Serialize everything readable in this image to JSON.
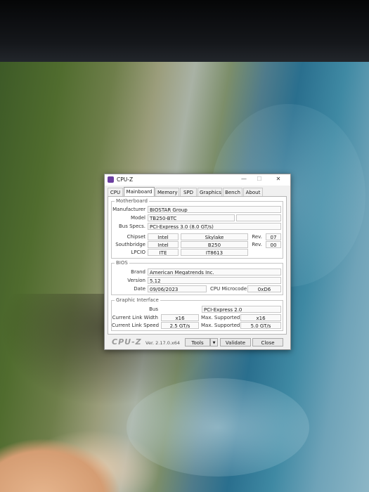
{
  "window": {
    "title": "CPU-Z"
  },
  "tabs": [
    {
      "label": "CPU"
    },
    {
      "label": "Mainboard"
    },
    {
      "label": "Memory"
    },
    {
      "label": "SPD"
    },
    {
      "label": "Graphics"
    },
    {
      "label": "Bench"
    },
    {
      "label": "About"
    }
  ],
  "active_tab": "Mainboard",
  "motherboard": {
    "legend": "Motherboard",
    "manufacturer_label": "Manufacturer",
    "manufacturer": "BIOSTAR Group",
    "model_label": "Model",
    "model": "TB250-BTC",
    "bus_specs_label": "Bus Specs.",
    "bus_specs": "PCI-Express 3.0 (8.0 GT/s)",
    "chipset_label": "Chipset",
    "chipset_vendor": "Intel",
    "chipset_model": "Skylake",
    "chipset_rev_label": "Rev.",
    "chipset_rev": "07",
    "southbridge_label": "Southbridge",
    "southbridge_vendor": "Intel",
    "southbridge_model": "B250",
    "southbridge_rev_label": "Rev.",
    "southbridge_rev": "00",
    "lpcio_label": "LPCIO",
    "lpcio_vendor": "ITE",
    "lpcio_model": "IT8613"
  },
  "bios": {
    "legend": "BIOS",
    "brand_label": "Brand",
    "brand": "American Megatrends Inc.",
    "version_label": "Version",
    "version": "5.12",
    "date_label": "Date",
    "date": "09/06/2023",
    "microcode_label": "CPU Microcode",
    "microcode": "0xD6"
  },
  "graphic_interface": {
    "legend": "Graphic Interface",
    "bus_label": "Bus",
    "bus": "PCI-Express 2.0",
    "link_width_label": "Current Link Width",
    "link_width": "x16",
    "max_supported_label": "Max. Supported",
    "max_width": "x16",
    "link_speed_label": "Current Link Speed",
    "link_speed": "2.5 GT/s",
    "max_speed": "5.0 GT/s"
  },
  "footer": {
    "logo": "CPU-Z",
    "version": "Ver. 2.17.0.x64",
    "tools_label": "Tools",
    "tools_arrow": "▼",
    "validate_label": "Validate",
    "close_label": "Close"
  },
  "titlebar_controls": {
    "minimize": "—",
    "maximize": "☐",
    "close": "✕"
  },
  "colors": {
    "window_bg": "#f0f0f0",
    "panel_bg": "#ffffff",
    "icon_accent": "#6b3fa0"
  }
}
